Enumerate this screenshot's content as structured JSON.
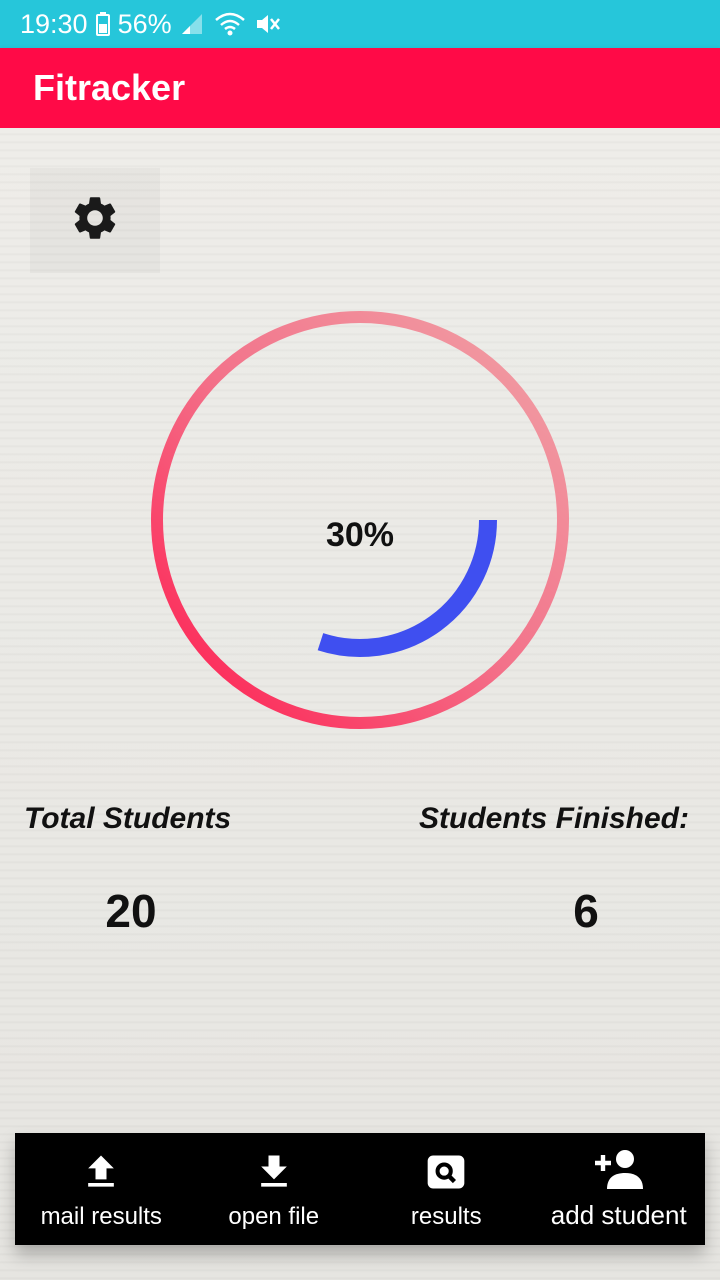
{
  "status_bar": {
    "time": "19:30",
    "battery": "56%",
    "icons": [
      "battery-icon",
      "signal-icon",
      "wifi-icon",
      "mute-icon"
    ]
  },
  "app_bar": {
    "title": "Fitracker"
  },
  "settings": {
    "icon": "gear-icon"
  },
  "progress": {
    "label": "30%",
    "value": 0.3,
    "ring_colors": [
      "#f0a3a7",
      "#ff1a4e"
    ],
    "arc_color": "#3f4ff0"
  },
  "stats": {
    "total_label": "Total Students",
    "total_value": "20",
    "finished_label": "Students Finished:",
    "finished_value": "6"
  },
  "bottom_nav": [
    {
      "label": "mail results",
      "icon": "upload-icon"
    },
    {
      "label": "open file",
      "icon": "download-icon"
    },
    {
      "label": "results",
      "icon": "search-icon"
    },
    {
      "label": "add student",
      "icon": "add-person-icon"
    }
  ],
  "colors": {
    "status_bar": "#26c6da",
    "app_bar": "#ff0a47",
    "nav_bg": "#000000"
  }
}
